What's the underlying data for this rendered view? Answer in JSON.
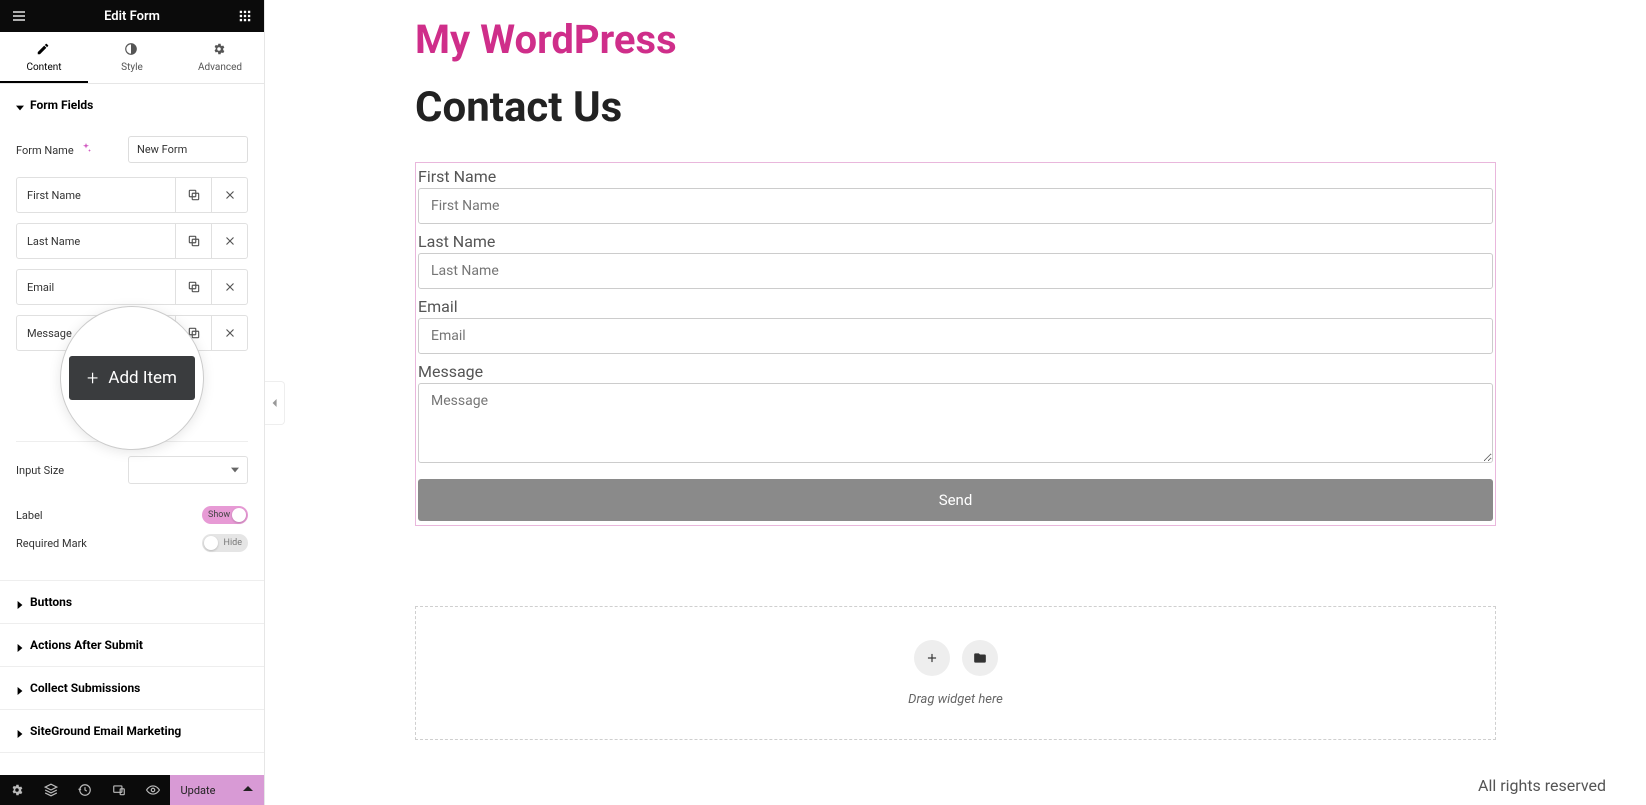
{
  "header": {
    "title": "Edit Form"
  },
  "tabs": {
    "content": "Content",
    "style": "Style",
    "advanced": "Advanced"
  },
  "panel": {
    "form_fields": {
      "title": "Form Fields",
      "form_name_label": "Form Name",
      "form_name_value": "New Form",
      "fields": [
        "First Name",
        "Last Name",
        "Email",
        "Message"
      ],
      "add_item": "Add Item",
      "input_size_label": "Input Size",
      "label_label": "Label",
      "label_toggle": "Show",
      "required_label": "Required Mark",
      "required_toggle": "Hide"
    },
    "sections": {
      "buttons": "Buttons",
      "actions": "Actions After Submit",
      "collect": "Collect Submissions",
      "siteground": "SiteGround Email Marketing"
    }
  },
  "bottombar": {
    "update": "Update"
  },
  "page": {
    "site_title": "My WordPress",
    "heading": "Contact Us",
    "fields": {
      "first_name": {
        "label": "First Name",
        "placeholder": "First Name"
      },
      "last_name": {
        "label": "Last Name",
        "placeholder": "Last Name"
      },
      "email": {
        "label": "Email",
        "placeholder": "Email"
      },
      "message": {
        "label": "Message",
        "placeholder": "Message"
      }
    },
    "send": "Send",
    "drag_hint": "Drag widget here",
    "footer": "All rights reserved"
  },
  "colors": {
    "accent": "#cf2e8a",
    "pink_light": "#d89ad5"
  }
}
